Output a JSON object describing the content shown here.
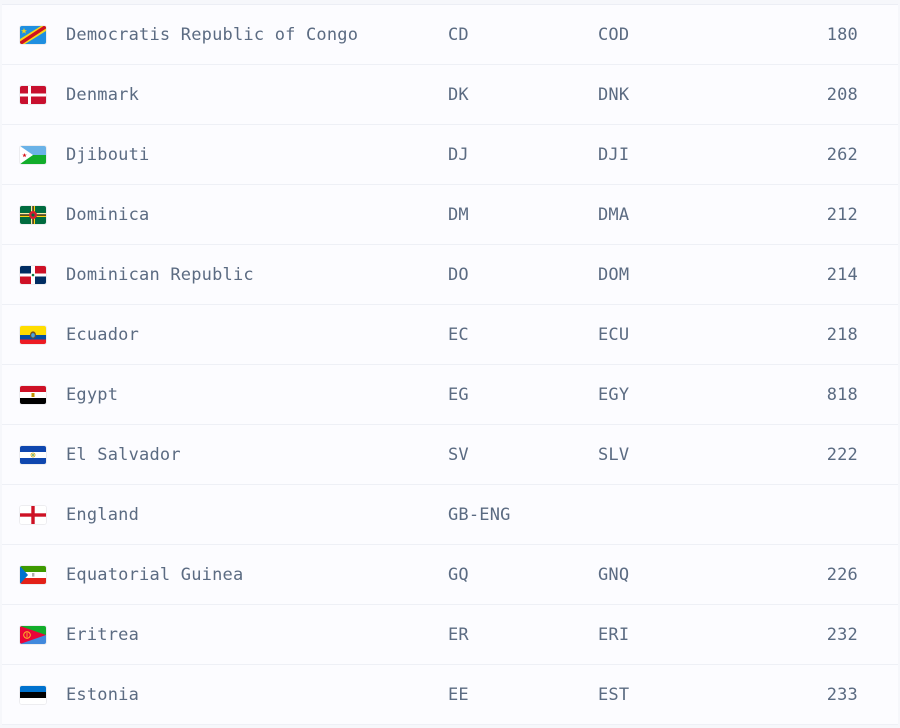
{
  "rows": [
    {
      "name": "Democratis Republic of Congo",
      "alpha2": "CD",
      "alpha3": "COD",
      "numeric": "180",
      "flag_icon": "flag-cd-icon"
    },
    {
      "name": "Denmark",
      "alpha2": "DK",
      "alpha3": "DNK",
      "numeric": "208",
      "flag_icon": "flag-dk-icon"
    },
    {
      "name": "Djibouti",
      "alpha2": "DJ",
      "alpha3": "DJI",
      "numeric": "262",
      "flag_icon": "flag-dj-icon"
    },
    {
      "name": "Dominica",
      "alpha2": "DM",
      "alpha3": "DMA",
      "numeric": "212",
      "flag_icon": "flag-dm-icon"
    },
    {
      "name": "Dominican Republic",
      "alpha2": "DO",
      "alpha3": "DOM",
      "numeric": "214",
      "flag_icon": "flag-do-icon"
    },
    {
      "name": "Ecuador",
      "alpha2": "EC",
      "alpha3": "ECU",
      "numeric": "218",
      "flag_icon": "flag-ec-icon"
    },
    {
      "name": "Egypt",
      "alpha2": "EG",
      "alpha3": "EGY",
      "numeric": "818",
      "flag_icon": "flag-eg-icon"
    },
    {
      "name": "El Salvador",
      "alpha2": "SV",
      "alpha3": "SLV",
      "numeric": "222",
      "flag_icon": "flag-sv-icon"
    },
    {
      "name": "England",
      "alpha2": "GB-ENG",
      "alpha3": "",
      "numeric": "",
      "flag_icon": "flag-gb-eng-icon"
    },
    {
      "name": "Equatorial Guinea",
      "alpha2": "GQ",
      "alpha3": "GNQ",
      "numeric": "226",
      "flag_icon": "flag-gq-icon"
    },
    {
      "name": "Eritrea",
      "alpha2": "ER",
      "alpha3": "ERI",
      "numeric": "232",
      "flag_icon": "flag-er-icon"
    },
    {
      "name": "Estonia",
      "alpha2": "EE",
      "alpha3": "EST",
      "numeric": "233",
      "flag_icon": "flag-ee-icon"
    }
  ],
  "colors": {
    "text": "#5b6b82",
    "row_bg": "#fcfcff",
    "divider": "#eef0f6"
  }
}
